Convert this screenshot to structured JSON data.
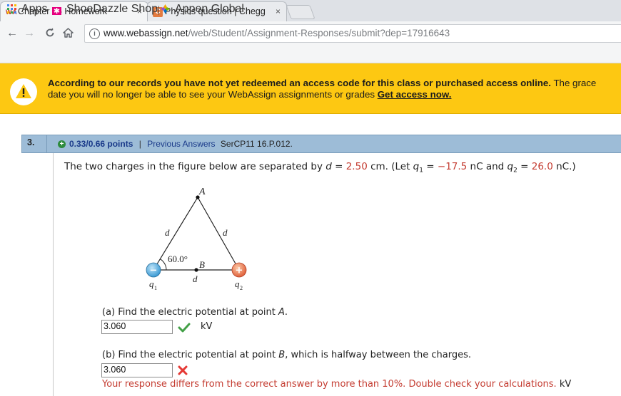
{
  "browser": {
    "tabs": [
      {
        "title": "Chapter 16 Homework",
        "favicon": "W A",
        "close": "×",
        "active": true
      },
      {
        "title": "Physics question | Chegg",
        "favicon": "C",
        "close": "×",
        "active": false
      }
    ],
    "url_host": "www.webassign.net",
    "url_path": "/web/Student/Assignment-Responses/submit?dep=17916643",
    "bookmarks": [
      {
        "label": "Apps",
        "icon": "apps-grid-icon"
      },
      {
        "label": "ShoeDazzle Shopping",
        "icon": "shoedazzle-icon"
      },
      {
        "label": "Appen Global",
        "icon": "appen-icon"
      }
    ]
  },
  "banner": {
    "bold_text": "According to our records you have not yet redeemed an access code for this class or purchased access online.",
    "line1_rest": " The grace",
    "line2": "date you will no longer be able to see your WebAssign assignments or grades ",
    "link": "Get access now."
  },
  "question": {
    "number": "3.",
    "points": "0.33/0.66 points",
    "separator": "|",
    "previous": "Previous Answers",
    "code": "SerCP11 16.P.012.",
    "prompt_start": "The two charges in the figure below are separated by ",
    "d_var": "d",
    "eq": " = ",
    "d_value": "2.50",
    "d_unit": " cm.",
    "let_text": "  (Let ",
    "q1_label": "q",
    "q1_sub": "1",
    "q1_value": "−17.5",
    "q_unit": " nC",
    "and_text": " and ",
    "q2_label": "q",
    "q2_sub": "2",
    "q2_value": "26.0",
    "q2_unit": " nC.)",
    "figure": {
      "label_a": "A",
      "label_b": "B",
      "label_d_left": "d",
      "label_d_right": "d",
      "label_d_bottom": "d",
      "angle": "60.0°",
      "q1": "q",
      "q1_sub": "1",
      "q2": "q",
      "q2_sub": "2",
      "minus": "−",
      "plus": "+"
    },
    "part_a": {
      "prompt_start": "(a) Find the electric potential at point ",
      "point": "A",
      "prompt_end": ".",
      "answer": "3.060",
      "unit": "kV",
      "status": "correct"
    },
    "part_b": {
      "prompt_start": "(b) Find the electric potential at point ",
      "point": "B",
      "prompt_end": ", which is halfway between the charges.",
      "answer": "3.060",
      "status": "incorrect",
      "feedback": "Your response differs from the correct answer by more than 10%. Double check your calculations.",
      "unit": "kV"
    }
  },
  "colors": {
    "banner": "#fdc812",
    "header": "#9dbcd7",
    "link": "#1a3a8a",
    "error": "#c43b30",
    "check": "#43a047"
  }
}
